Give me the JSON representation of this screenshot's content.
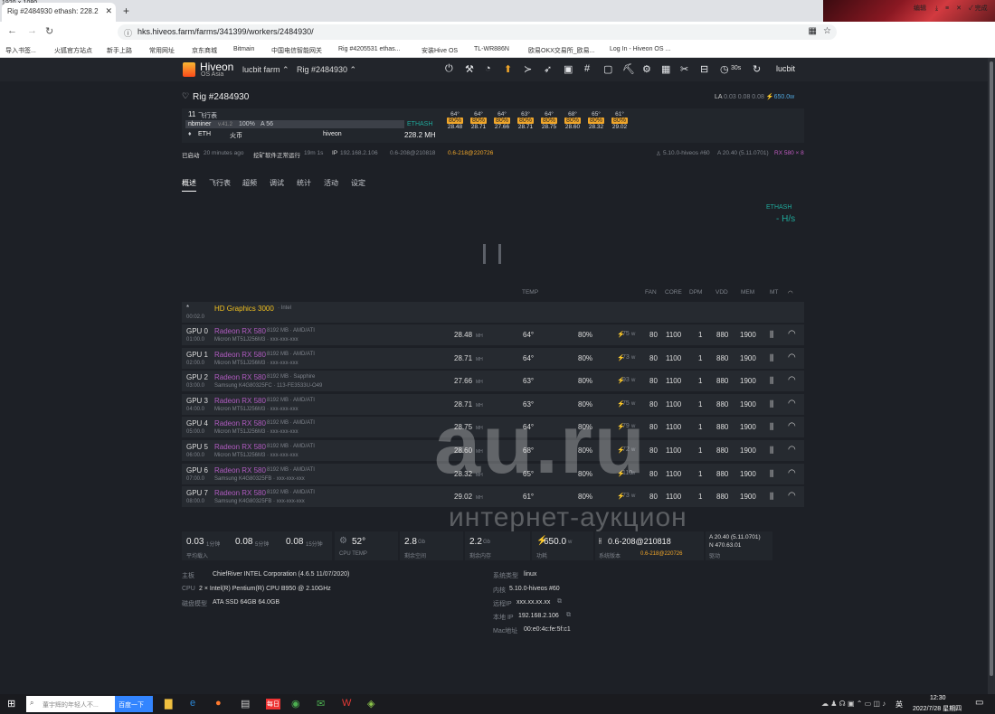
{
  "screen_label": "1920 × 1080",
  "browser": {
    "tab_title": "Rig #2484930 ethash: 228.2",
    "url": "hks.hiveos.farm/farms/341399/workers/2484930/",
    "bookmarks": [
      "导入书签...",
      "火狐官方站点",
      "新手上路",
      "常用网址",
      "京东商城",
      "Bitmain",
      "中国电信智能网关",
      "Rig #4205531 ethas...",
      "安装Hive OS",
      "TL-WR886N",
      "欧易OKX交易所_欧易...",
      "Log In - Hiveon OS ..."
    ],
    "right_controls": [
      "编辑",
      "完成"
    ]
  },
  "nav": {
    "logo": "Hiveon",
    "logo_sub": "OS Asia",
    "farm": "lucbit farm ⌃",
    "rig": "Rig #2484930 ⌃",
    "timer": "30s",
    "user": "lucbit",
    "icons": [
      "power-icon",
      "tools-icon",
      "wifi-icon",
      "upload-icon",
      "terminal-icon",
      "rocket-icon",
      "image-icon",
      "hash-icon",
      "window-icon",
      "pickaxe-icon",
      "mining-icon",
      "grid-icon",
      "wrench-icon",
      "minus-icon",
      "timer-icon",
      "refresh-icon"
    ]
  },
  "rig": {
    "title": "Rig #2484930",
    "la_label": "LA",
    "la": "0.03 0.08 0.08",
    "power": "650.0w",
    "flight_sheets": "11",
    "flight_sheets_label": "飞行表",
    "miner": "nbminer",
    "miner_ver": "v.41.2",
    "miner_pct": "100%",
    "miner_a": "A 56",
    "algo": "ETHASH",
    "coin": "ETH",
    "pool": "火币",
    "wallet": "hiveon",
    "hashrate": "228.2 MH",
    "temps": [
      "64°",
      "64°",
      "64°",
      "63°",
      "64°",
      "68°",
      "65°",
      "61°"
    ],
    "fans": [
      "80%",
      "80%",
      "80%",
      "80%",
      "80%",
      "80%",
      "80%",
      "80%"
    ],
    "rates": [
      "28.48",
      "28.71",
      "27.66",
      "28.71",
      "28.75",
      "28.60",
      "28.32",
      "29.02"
    ],
    "boot_label": "已启动",
    "boot": "20 minutes ago",
    "miner_status": "挖矿软件正常运行",
    "miner_uptime": "19m 1s",
    "ip_label": "IP",
    "ip": "192.168.2.106",
    "driver": "0.6-208@210818",
    "driver_upd": "0.6-218@220726",
    "kernel": "5.10.0-hiveos #60",
    "amd": "A 20.40 (5.11.0701)",
    "gpu_model": "RX 580 × 8"
  },
  "tabs": [
    "概述",
    "飞行表",
    "超频",
    "调试",
    "统计",
    "活动",
    "设定"
  ],
  "chart": {
    "algo": "ETHASH",
    "rate": "- H/s"
  },
  "gpu_head": {
    "temp": "TEMP",
    "fan": "FAN",
    "core": "CORE",
    "dpm": "DPM",
    "vdd": "VDD",
    "mem": "MEM",
    "mt": "MT"
  },
  "igpu": {
    "star": "*",
    "name": "HD Graphics 3000",
    "vendor": "· Intel",
    "bus": "00:02.0"
  },
  "gpus": [
    {
      "id": "GPU 0",
      "bus": "01:00.0",
      "name": "Radeon RX 580",
      "spec": "8192 MB · AMD/ATI",
      "mem": "Micron MT51J256M3 · xxx-xxx-xxx",
      "rate": "28.48",
      "temp": "64°",
      "fan": "80%",
      "w": "75",
      "fanv": "80",
      "core": "1100",
      "dpm": "1",
      "vdd": "880",
      "memc": "1900"
    },
    {
      "id": "GPU 1",
      "bus": "02:00.0",
      "name": "Radeon RX 580",
      "spec": "8192 MB · AMD/ATI",
      "mem": "Micron MT51J256M3 · xxx-xxx-xxx",
      "rate": "28.71",
      "temp": "64°",
      "fan": "80%",
      "w": "73",
      "fanv": "80",
      "core": "1100",
      "dpm": "1",
      "vdd": "880",
      "memc": "1900"
    },
    {
      "id": "GPU 2",
      "bus": "03:00.0",
      "name": "Radeon RX 580",
      "spec": "8192 MB · Sapphire",
      "mem": "Samsung K4G80325FC · 113-FE3533U-O49",
      "rate": "27.66",
      "temp": "63°",
      "fan": "80%",
      "w": "93",
      "fanv": "80",
      "core": "1100",
      "dpm": "1",
      "vdd": "880",
      "memc": "1900"
    },
    {
      "id": "GPU 3",
      "bus": "04:00.0",
      "name": "Radeon RX 580",
      "spec": "8192 MB · AMD/ATI",
      "mem": "Micron MT51J256M3 · xxx-xxx-xxx",
      "rate": "28.71",
      "temp": "63°",
      "fan": "80%",
      "w": "75",
      "fanv": "80",
      "core": "1100",
      "dpm": "1",
      "vdd": "880",
      "memc": "1900"
    },
    {
      "id": "GPU 4",
      "bus": "05:00.0",
      "name": "Radeon RX 580",
      "spec": "8192 MB · AMD/ATI",
      "mem": "Micron MT51J256M3 · xxx-xxx-xxx",
      "rate": "28.75",
      "temp": "64°",
      "fan": "80%",
      "w": "79",
      "fanv": "80",
      "core": "1100",
      "dpm": "1",
      "vdd": "880",
      "memc": "1900"
    },
    {
      "id": "GPU 5",
      "bus": "06:00.0",
      "name": "Radeon RX 580",
      "spec": "8192 MB · AMD/ATI",
      "mem": "Micron MT51J256M3 · xxx-xxx-xxx",
      "rate": "28.60",
      "temp": "68°",
      "fan": "80%",
      "w": "72",
      "fanv": "80",
      "core": "1100",
      "dpm": "1",
      "vdd": "880",
      "memc": "1900"
    },
    {
      "id": "GPU 6",
      "bus": "07:00.0",
      "name": "Radeon RX 580",
      "spec": "8192 MB · AMD/ATI",
      "mem": "Samsung K4G80325FB · xxx-xxx-xxx",
      "rate": "28.32",
      "temp": "65°",
      "fan": "80%",
      "w": "110",
      "fanv": "80",
      "core": "1100",
      "dpm": "1",
      "vdd": "880",
      "memc": "1900"
    },
    {
      "id": "GPU 7",
      "bus": "08:00.0",
      "name": "Radeon RX 580",
      "spec": "8192 MB · AMD/ATI",
      "mem": "Samsung K4G80325FB · xxx-xxx-xxx",
      "rate": "29.02",
      "temp": "61°",
      "fan": "80%",
      "w": "73",
      "fanv": "80",
      "core": "1100",
      "dpm": "1",
      "vdd": "880",
      "memc": "1900"
    }
  ],
  "rate_unit": "MH",
  "w_unit": "w",
  "stats": {
    "la1": "0.03",
    "la1_u": "1分钟",
    "la5": "0.08",
    "la5_u": "5分钟",
    "la15": "0.08",
    "la15_u": "15分钟",
    "la_label": "平均载入",
    "cpu_temp": "52°",
    "cpu_temp_label": "CPU TEMP",
    "disk": "2.8",
    "disk_u": "Gb",
    "disk_label": "剩余空间",
    "ram": "2.2",
    "ram_u": "Gb",
    "ram_label": "剩余内存",
    "power": "650.0",
    "power_u": "w",
    "power_label": "功耗",
    "ver": "0.6-208@210818",
    "ver_upd": "0.6-218@220726",
    "ver_label": "系统版本",
    "drv_a": "20.40 (5.11.0701)",
    "drv_n": "470.63.01",
    "drv_label": "驱动"
  },
  "sys": {
    "mb_label": "主板",
    "mb": "ChiefRiver INTEL Corporation (4.6.5 11/07/2020)",
    "cpu_label": "CPU",
    "cpu": "2 × Intel(R) Pentium(R) CPU B950 @ 2.10GHz",
    "disk_label": "磁盘模型",
    "disk": "ATA SSD 64GB 64.0GB",
    "os_label": "系统类型",
    "os": "linux",
    "kernel_label": "内核",
    "kernel": "5.10.0-hiveos #60",
    "rip_label": "远程IP",
    "rip": "xxx.xx.xx.xx",
    "lip_label": "本地 IP",
    "lip": "192.168.2.106",
    "mac_label": "Mac地址",
    "mac": "00:e0:4c:fe:5f:c1"
  },
  "watermark": {
    "main": "au.ru",
    "sub": "интернет-аукцион"
  },
  "taskbar": {
    "search": "董宇辉的年轻人不...",
    "search_btn": "百度一下",
    "time": "12:30",
    "date": "2022/7/28 星期四",
    "lang": "英"
  }
}
